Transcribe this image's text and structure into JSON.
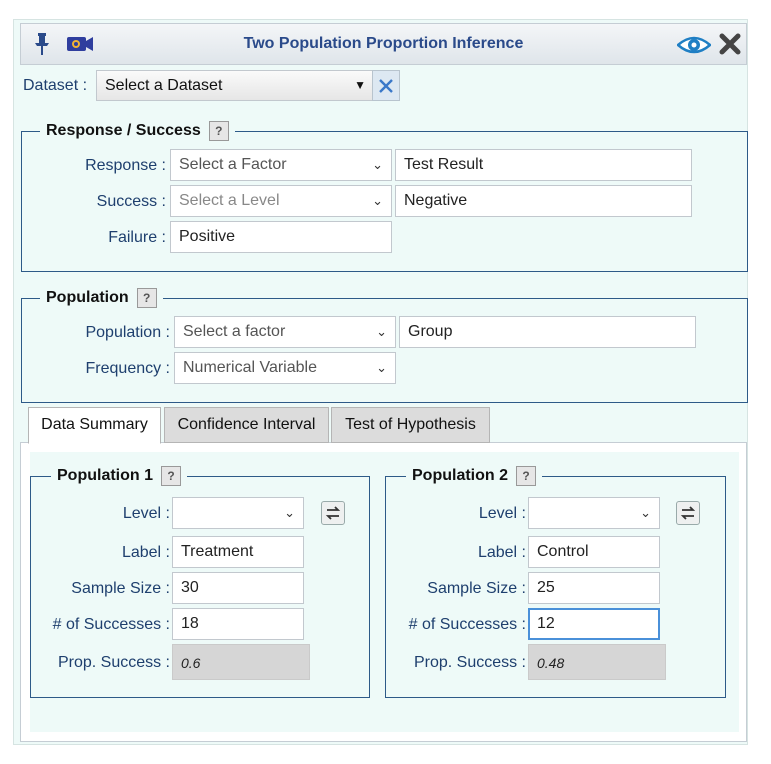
{
  "window": {
    "title": "Two Population Proportion Inference",
    "icons": [
      "pin-icon",
      "camera-icon",
      "eye-icon",
      "close-icon"
    ]
  },
  "dataset": {
    "label": "Dataset :",
    "placeholder": "Select a Dataset"
  },
  "response_success": {
    "title": "Response / Success",
    "help": "?",
    "response_label": "Response :",
    "response_select": "Select a Factor",
    "response_value": "Test Result",
    "success_label": "Success :",
    "success_select": "Select a Level",
    "success_value": "Negative",
    "failure_label": "Failure :",
    "failure_value": "Positive"
  },
  "population": {
    "title": "Population",
    "help": "?",
    "population_label": "Population :",
    "population_select": "Select a factor",
    "population_value": "Group",
    "frequency_label": "Frequency :",
    "frequency_select": "Numerical Variable"
  },
  "tabs": [
    {
      "label": "Data Summary",
      "active": true
    },
    {
      "label": "Confidence Interval",
      "active": false
    },
    {
      "label": "Test of Hypothesis",
      "active": false
    }
  ],
  "pop1": {
    "title": "Population 1",
    "help": "?",
    "level_label": "Level :",
    "level_value": "",
    "label_label": "Label :",
    "label_value": "Treatment",
    "size_label": "Sample Size :",
    "size_value": "30",
    "successes_label": "# of Successes :",
    "successes_value": "18",
    "prop_label": "Prop. Success :",
    "prop_value": "0.6"
  },
  "pop2": {
    "title": "Population 2",
    "help": "?",
    "level_label": "Level :",
    "level_value": "",
    "label_label": "Label :",
    "label_value": "Control",
    "size_label": "Sample Size :",
    "size_value": "25",
    "successes_label": "# of Successes :",
    "successes_value": "12",
    "prop_label": "Prop. Success :",
    "prop_value": "0.48"
  },
  "colors": {
    "background": "#eefaf8",
    "title": "#2a4a8a",
    "label": "#1e3f6e",
    "border": "#2d5a88"
  }
}
